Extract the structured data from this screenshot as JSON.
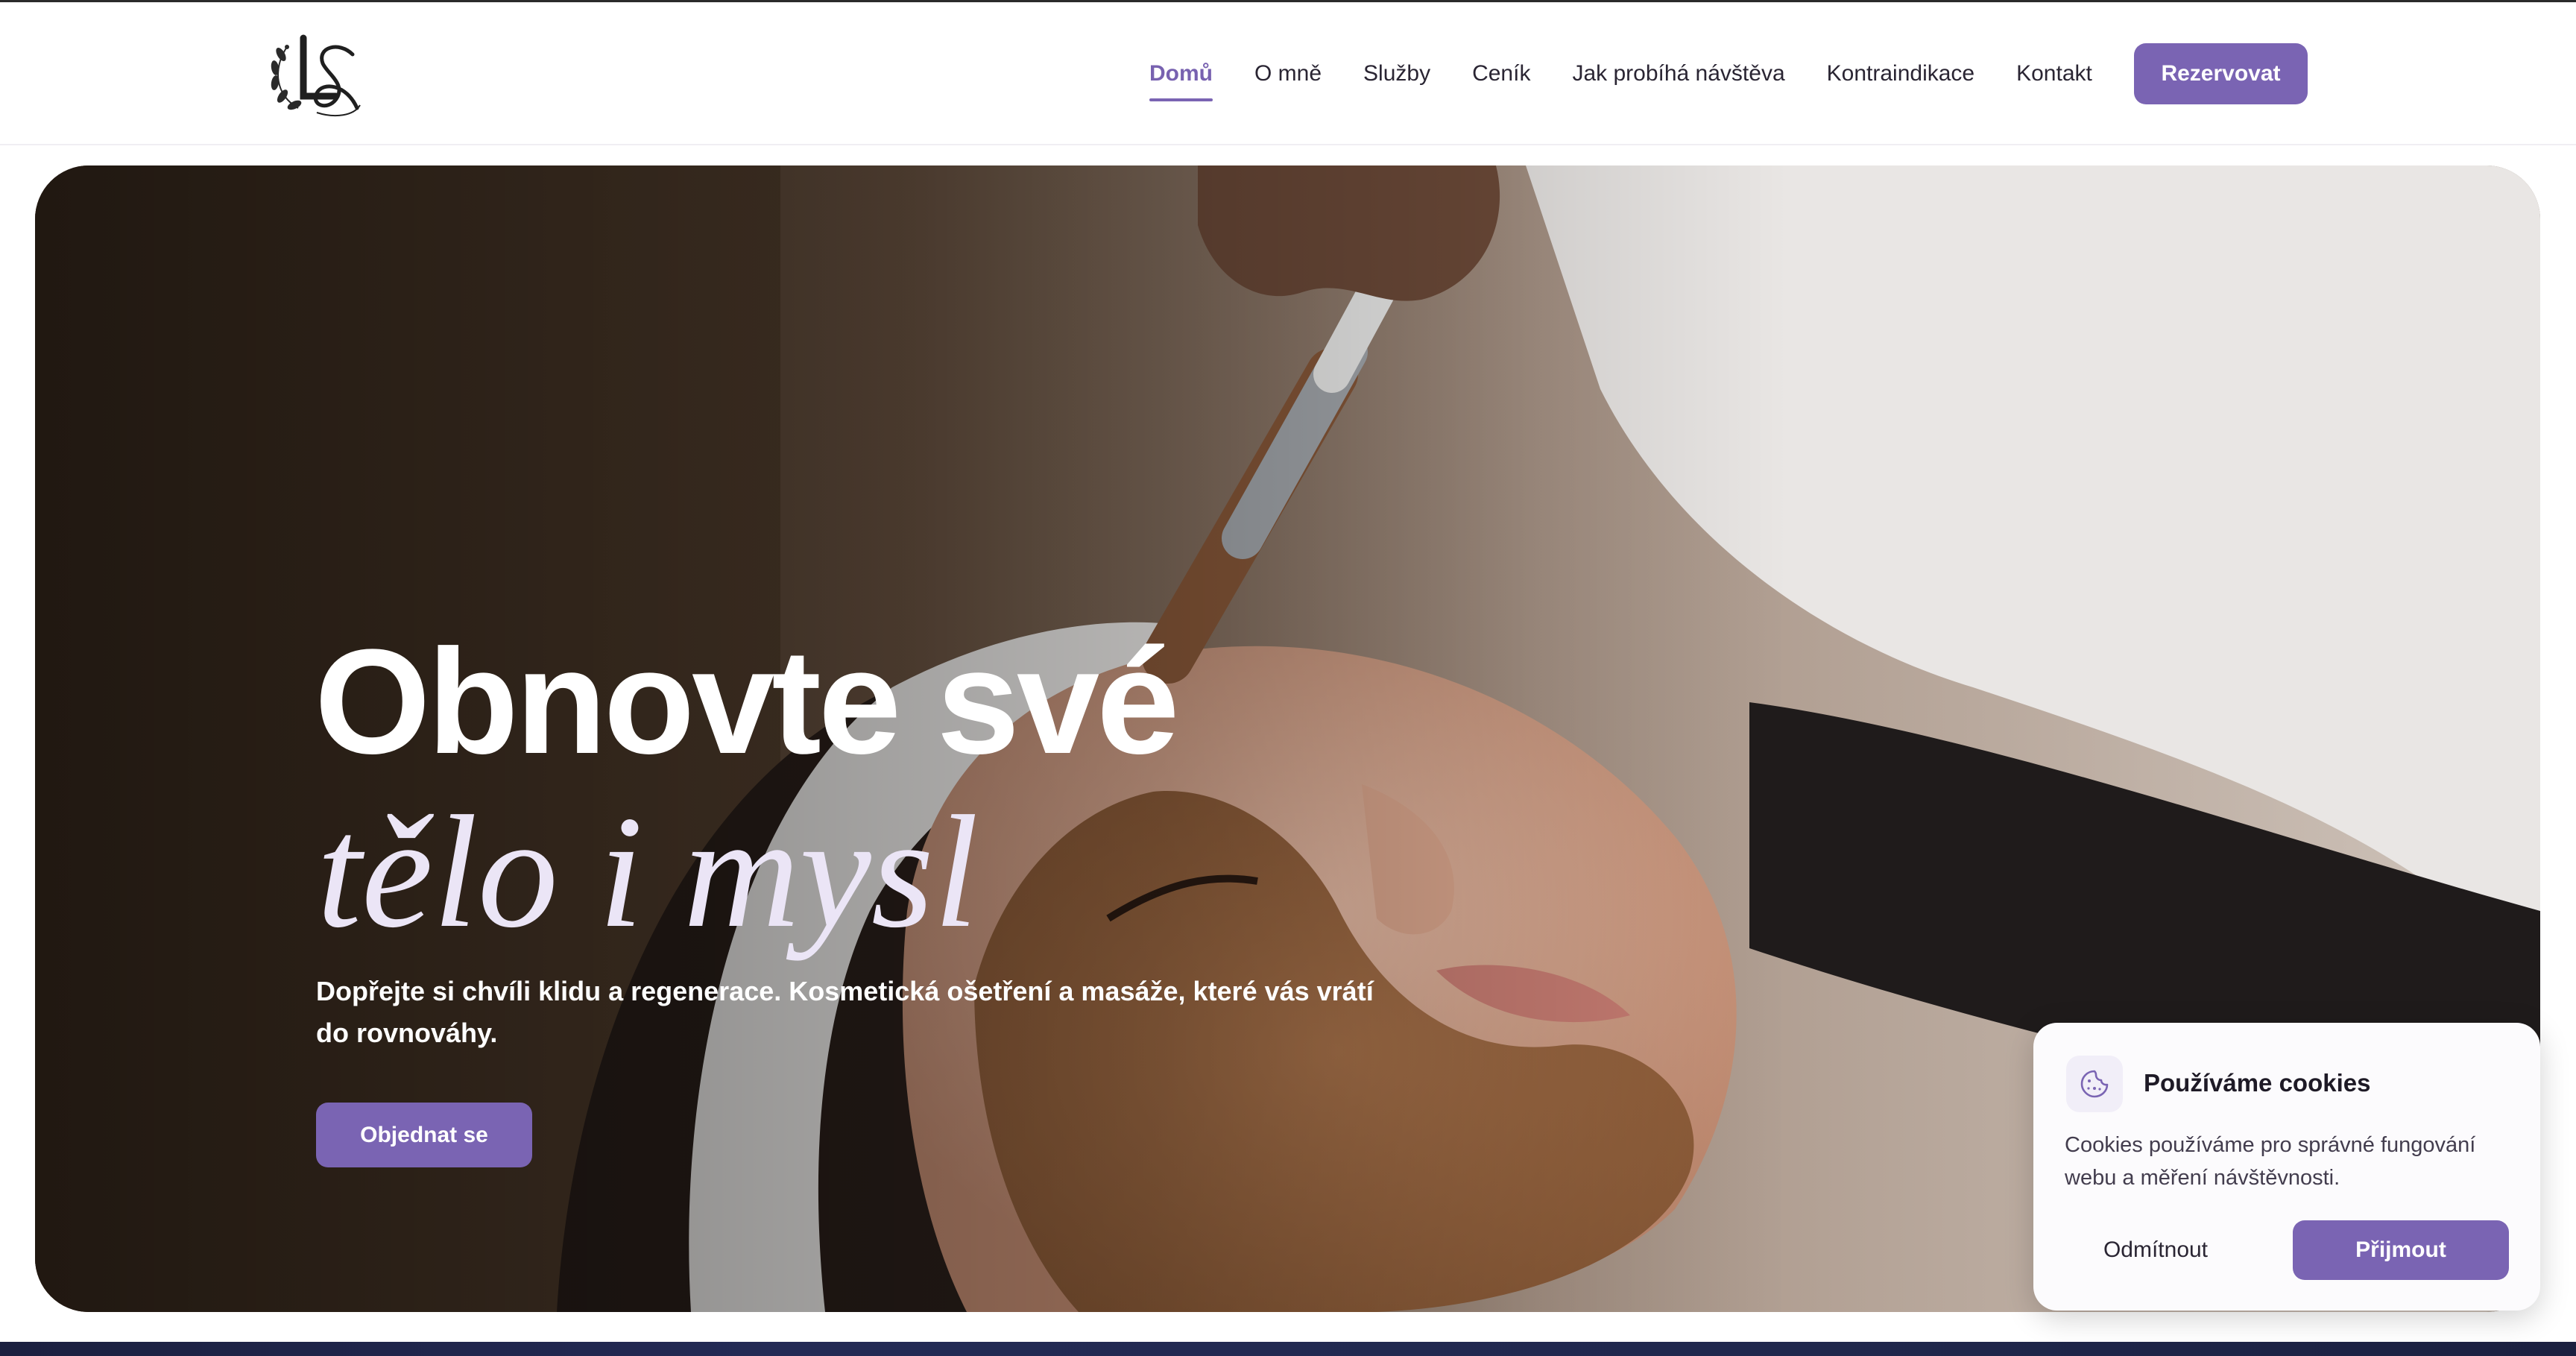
{
  "nav": {
    "items": [
      {
        "label": "Domů",
        "active": true
      },
      {
        "label": "O mně"
      },
      {
        "label": "Služby"
      },
      {
        "label": "Ceník"
      },
      {
        "label": "Jak probíhá návštěva"
      },
      {
        "label": "Kontraindikace"
      },
      {
        "label": "Kontakt"
      }
    ],
    "cta_label": "Rezervovat"
  },
  "hero": {
    "headline_line1": "Obnovte své",
    "headline_line2": "tělo i mysl",
    "lead": "Dopřejte si chvíli klidu a regenerace. Kosmetická ošetření a masáže, které vás vrátí do rovnováhy.",
    "cta_label": "Objednat se"
  },
  "cookie": {
    "icon": "cookie-icon",
    "title": "Používáme cookies",
    "text": "Cookies používáme pro správné fungování webu a měření návštěvnosti.",
    "decline_label": "Odmítnout",
    "accept_label": "Přijmout"
  },
  "colors": {
    "accent": "#7a64b3",
    "text_dark": "#2a2533",
    "headline_italic": "#ebe5f6"
  }
}
